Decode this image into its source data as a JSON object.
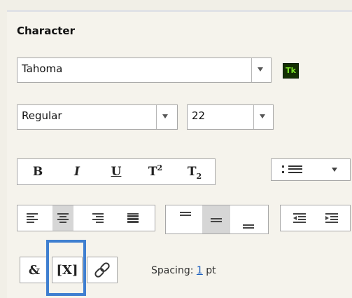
{
  "section": {
    "title": "Character"
  },
  "font_family": {
    "value": "Tahoma"
  },
  "typekit": {
    "label": "Tk",
    "bg": "#132f02",
    "fg": "#7ce32a"
  },
  "font_style": {
    "value": "Regular"
  },
  "font_size": {
    "value": "22"
  },
  "style_buttons": {
    "bold": "B",
    "italic": "I",
    "underline": "U",
    "superscript_base": "T",
    "superscript_mark": "2",
    "subscript_base": "T",
    "subscript_mark": "2"
  },
  "icons": {
    "list": "bullet-list-icon",
    "ampersand": "&",
    "variable": "[X]",
    "link": "link-icon"
  },
  "spacing": {
    "label": "Spacing:",
    "value": "1",
    "unit": "pt"
  },
  "colors": {
    "highlight": "#3f7fd0",
    "link": "#1d5fbf"
  }
}
